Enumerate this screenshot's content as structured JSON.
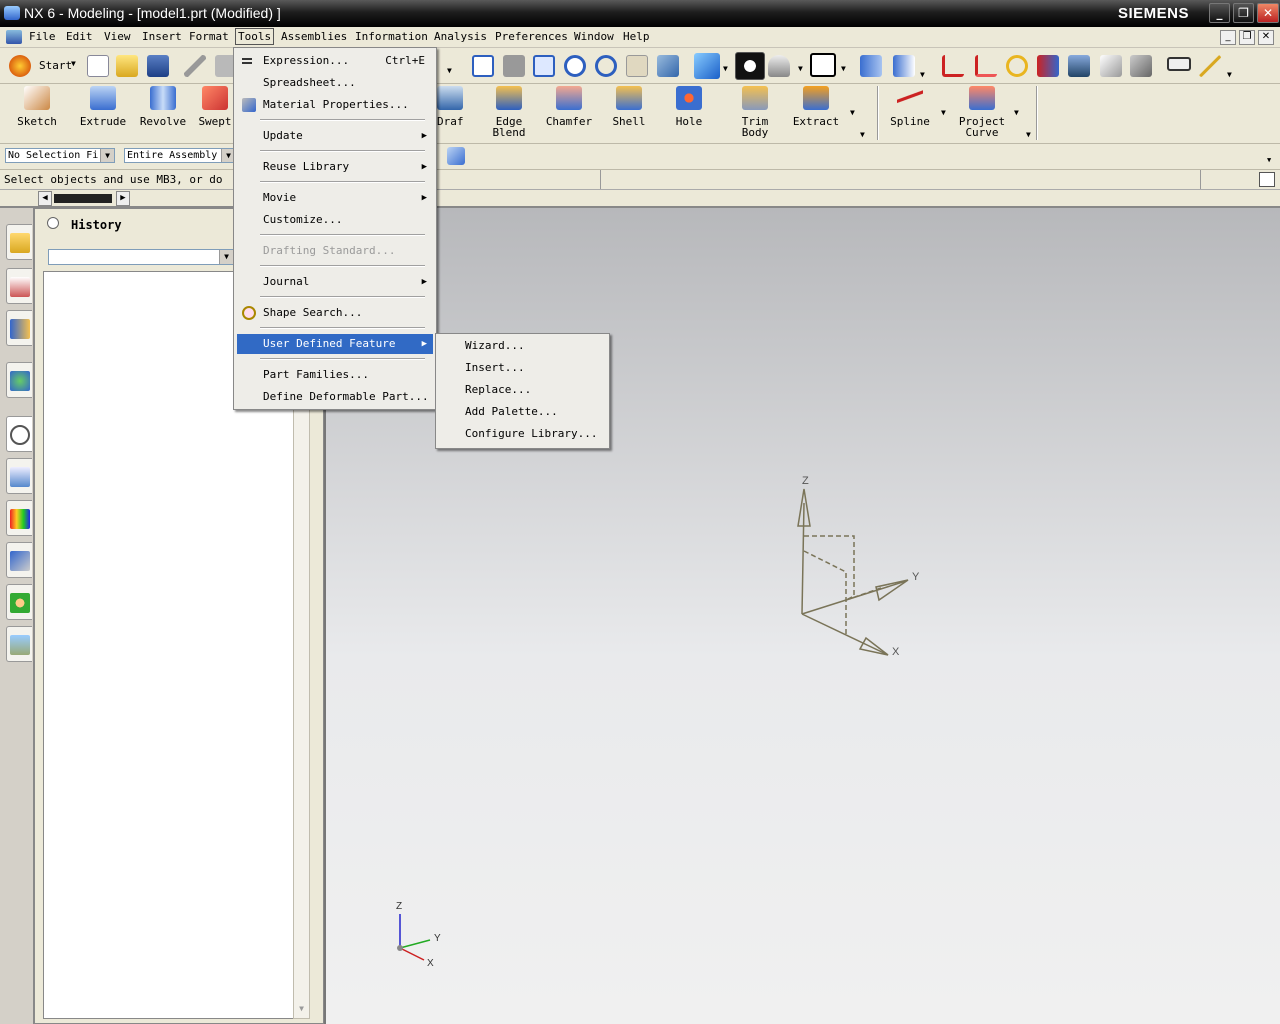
{
  "window": {
    "title": "NX 6 - Modeling - [model1.prt (Modified) ]",
    "brand": "SIEMENS"
  },
  "menubar": [
    "File",
    "Edit",
    "View",
    "Insert",
    "Format",
    "Tools",
    "Assemblies",
    "Information",
    "Analysis",
    "Preferences",
    "Window",
    "Help"
  ],
  "toolbar_start": {
    "label": "Start"
  },
  "feature_toolbar": [
    {
      "label": "Sketch",
      "icon": "sketch-icon"
    },
    {
      "label": "Extrude",
      "icon": "extrude-icon"
    },
    {
      "label": "Revolve",
      "icon": "revolve-icon"
    },
    {
      "label": "Swept",
      "icon": "swept-icon"
    },
    {
      "label": "Draft",
      "icon": "draft-icon"
    },
    {
      "label": "Edge\nBlend",
      "icon": "edge-blend-icon"
    },
    {
      "label": "Chamfer",
      "icon": "chamfer-icon"
    },
    {
      "label": "Shell",
      "icon": "shell-icon"
    },
    {
      "label": "Hole",
      "icon": "hole-icon"
    },
    {
      "label": "Trim\nBody",
      "icon": "trim-body-icon"
    },
    {
      "label": "Extract",
      "icon": "extract-icon"
    },
    {
      "label": "Spline",
      "icon": "spline-icon"
    },
    {
      "label": "Project\nCurve",
      "icon": "project-curve-icon"
    }
  ],
  "selection_bar": {
    "filter": "No Selection Fi",
    "scope": "Entire Assembly"
  },
  "status": {
    "message": "Select objects and use MB3, or do"
  },
  "navigator": {
    "title": "History"
  },
  "tools_menu": {
    "items": [
      {
        "label": "Expression...",
        "shortcut": "Ctrl+E",
        "icon": "expression-icon"
      },
      {
        "label": "Spreadsheet..."
      },
      {
        "label": "Material Properties...",
        "icon": "material-icon"
      },
      {
        "label": "Update",
        "submenu": true
      },
      {
        "label": "Reuse Library",
        "submenu": true
      },
      {
        "label": "Movie",
        "submenu": true
      },
      {
        "label": "Customize..."
      },
      {
        "label": "Drafting Standard...",
        "disabled": true
      },
      {
        "label": "Journal",
        "submenu": true
      },
      {
        "label": "Shape Search...",
        "icon": "shape-search-icon"
      },
      {
        "label": "User Defined Feature",
        "submenu": true,
        "highlighted": true
      },
      {
        "label": "Part Families..."
      },
      {
        "label": "Define Deformable Part..."
      }
    ]
  },
  "udf_submenu": [
    "Wizard...",
    "Insert...",
    "Replace...",
    "Add Palette...",
    "Configure Library..."
  ],
  "triad": {
    "x": "X",
    "y": "Y",
    "z": "Z"
  },
  "colors": {
    "highlight": "#316ac5",
    "triad": "#7a7458",
    "viewport_top": "#b7b8bb",
    "viewport_bottom": "#f0f0f0"
  }
}
